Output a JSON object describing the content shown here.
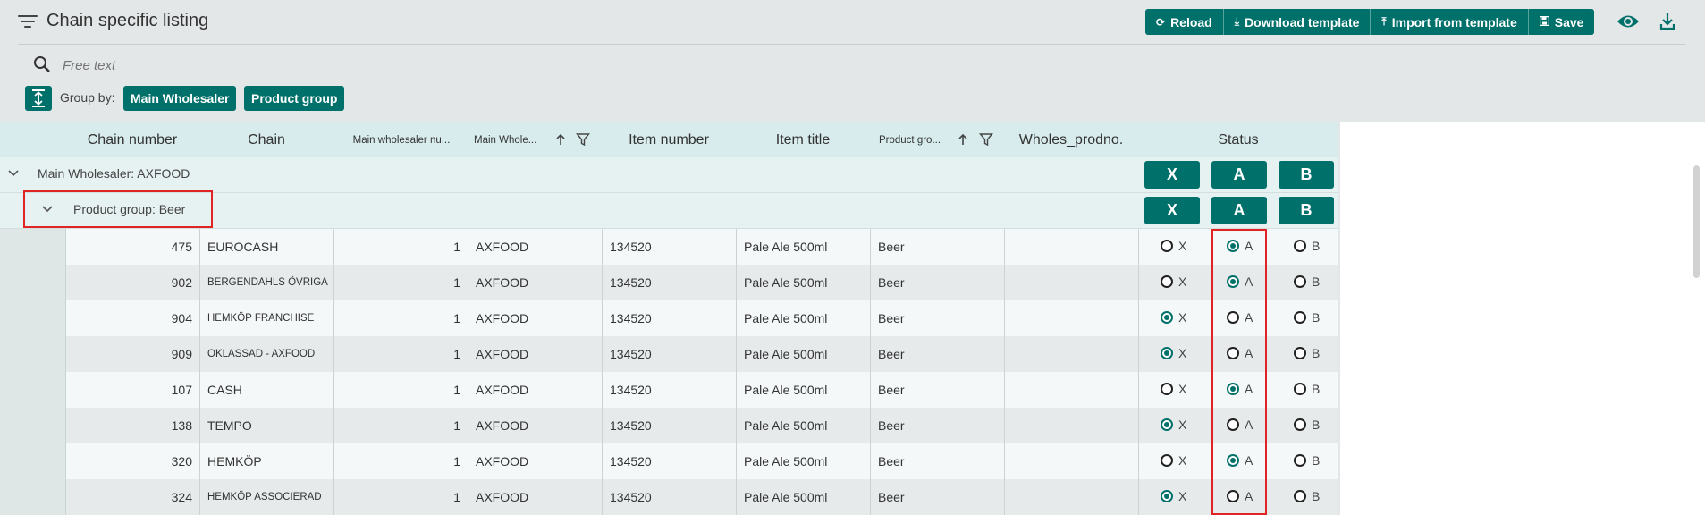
{
  "header": {
    "title": "Chain specific listing",
    "menu_icon": "menu-filter-icon",
    "buttons": [
      {
        "label": "Reload",
        "icon": "refresh-icon"
      },
      {
        "label": "Download template",
        "icon": "download-icon"
      },
      {
        "label": "Import from template",
        "icon": "upload-icon"
      },
      {
        "label": "Save",
        "icon": "floppy-disk-icon"
      }
    ],
    "view_icon": "eye-icon",
    "export_icon": "download-icon"
  },
  "search": {
    "placeholder": "Free text",
    "value": ""
  },
  "group_by": {
    "label": "Group by:",
    "chips": [
      "Main Wholesaler",
      "Product group"
    ]
  },
  "columns": [
    {
      "label": "Chain number"
    },
    {
      "label": "Chain"
    },
    {
      "label": "Main wholesaler nu..."
    },
    {
      "label": "Main Whole...",
      "sorted": "asc",
      "filter": true
    },
    {
      "label": "Item number"
    },
    {
      "label": "Item title"
    },
    {
      "label": "Product gro...",
      "sorted": "asc",
      "filter": true
    },
    {
      "label": "Wholes_prodno."
    },
    {
      "label": "Status"
    }
  ],
  "groups": {
    "wholesaler": "Main Wholesaler: AXFOOD",
    "product_group": "Product group: Beer",
    "status_buttons": [
      "X",
      "A",
      "B"
    ]
  },
  "rows": [
    {
      "chain_number": "475",
      "chain": "EUROCASH",
      "wholesaler_number": "1",
      "wholesaler": "AXFOOD",
      "item_number": "134520",
      "item_title": "Pale Ale 500ml",
      "product_group": "Beer",
      "wholes_prodno": "",
      "status": "A"
    },
    {
      "chain_number": "902",
      "chain": "BERGENDAHLS ÖVRIGA",
      "wholesaler_number": "1",
      "wholesaler": "AXFOOD",
      "item_number": "134520",
      "item_title": "Pale Ale 500ml",
      "product_group": "Beer",
      "wholes_prodno": "",
      "status": "A"
    },
    {
      "chain_number": "904",
      "chain": "HEMKÖP FRANCHISE",
      "wholesaler_number": "1",
      "wholesaler": "AXFOOD",
      "item_number": "134520",
      "item_title": "Pale Ale 500ml",
      "product_group": "Beer",
      "wholes_prodno": "",
      "status": "X"
    },
    {
      "chain_number": "909",
      "chain": "OKLASSAD - AXFOOD",
      "wholesaler_number": "1",
      "wholesaler": "AXFOOD",
      "item_number": "134520",
      "item_title": "Pale Ale 500ml",
      "product_group": "Beer",
      "wholes_prodno": "",
      "status": "X"
    },
    {
      "chain_number": "107",
      "chain": "CASH",
      "wholesaler_number": "1",
      "wholesaler": "AXFOOD",
      "item_number": "134520",
      "item_title": "Pale Ale 500ml",
      "product_group": "Beer",
      "wholes_prodno": "",
      "status": "A"
    },
    {
      "chain_number": "138",
      "chain": "TEMPO",
      "wholesaler_number": "1",
      "wholesaler": "AXFOOD",
      "item_number": "134520",
      "item_title": "Pale Ale 500ml",
      "product_group": "Beer",
      "wholes_prodno": "",
      "status": "X"
    },
    {
      "chain_number": "320",
      "chain": "HEMKÖP",
      "wholesaler_number": "1",
      "wholesaler": "AXFOOD",
      "item_number": "134520",
      "item_title": "Pale Ale 500ml",
      "product_group": "Beer",
      "wholes_prodno": "",
      "status": "A"
    },
    {
      "chain_number": "324",
      "chain": "HEMKÖP ASSOCIERAD",
      "wholesaler_number": "1",
      "wholesaler": "AXFOOD",
      "item_number": "134520",
      "item_title": "Pale Ale 500ml",
      "product_group": "Beer",
      "wholes_prodno": "",
      "status": "X"
    }
  ],
  "status_options": [
    "X",
    "A",
    "B"
  ],
  "colors": {
    "accent": "#00706b",
    "highlight": "#e02424"
  }
}
